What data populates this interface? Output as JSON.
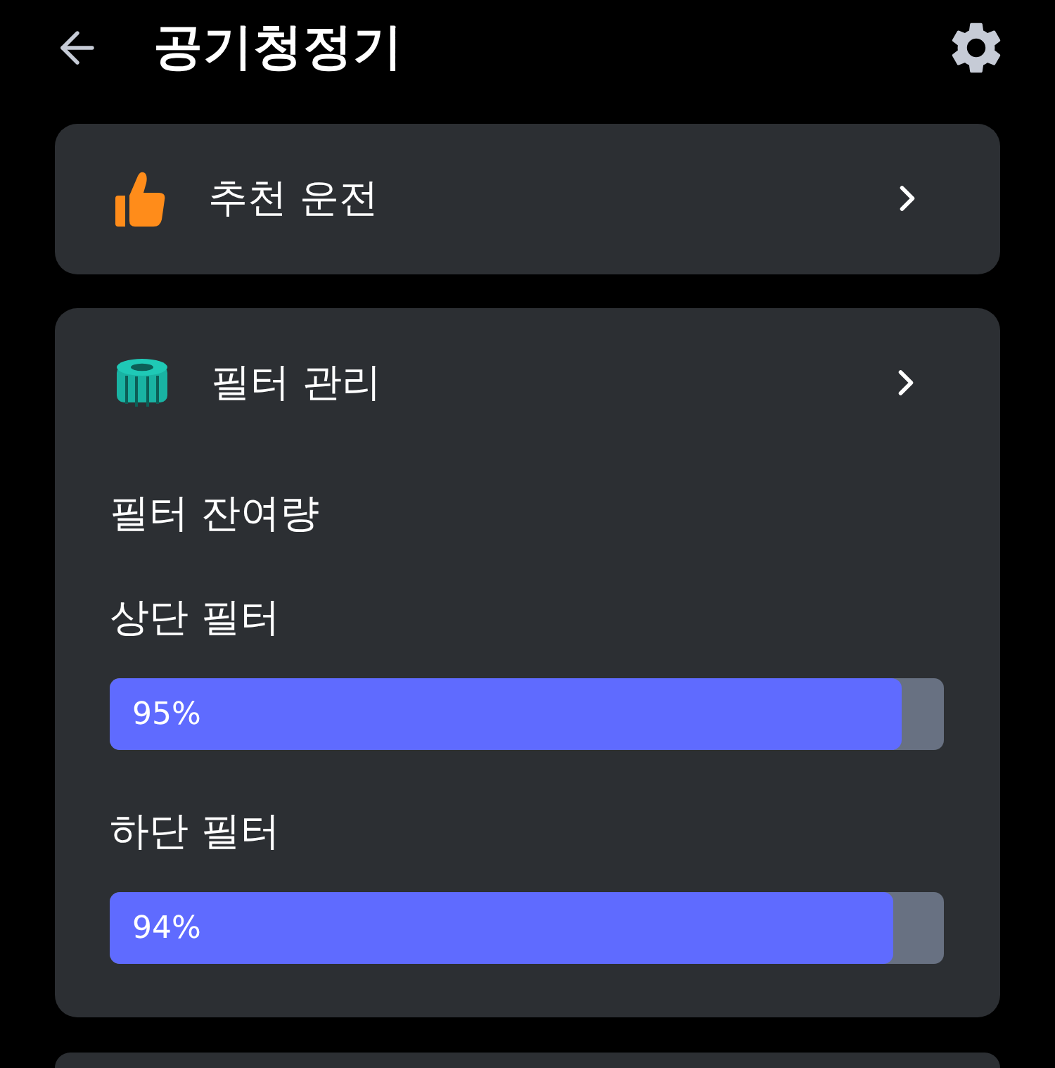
{
  "header": {
    "title": "공기청정기"
  },
  "menu_items": [
    {
      "label": "추천 운전"
    }
  ],
  "filter_card": {
    "title": "필터 관리",
    "section_title": "필터 잔여량",
    "filters": [
      {
        "name": "상단 필터",
        "level": 0.95,
        "reading": "95%"
      },
      {
        "name": "하단 필터",
        "level": 0.94,
        "reading": "94%"
      }
    ]
  }
}
